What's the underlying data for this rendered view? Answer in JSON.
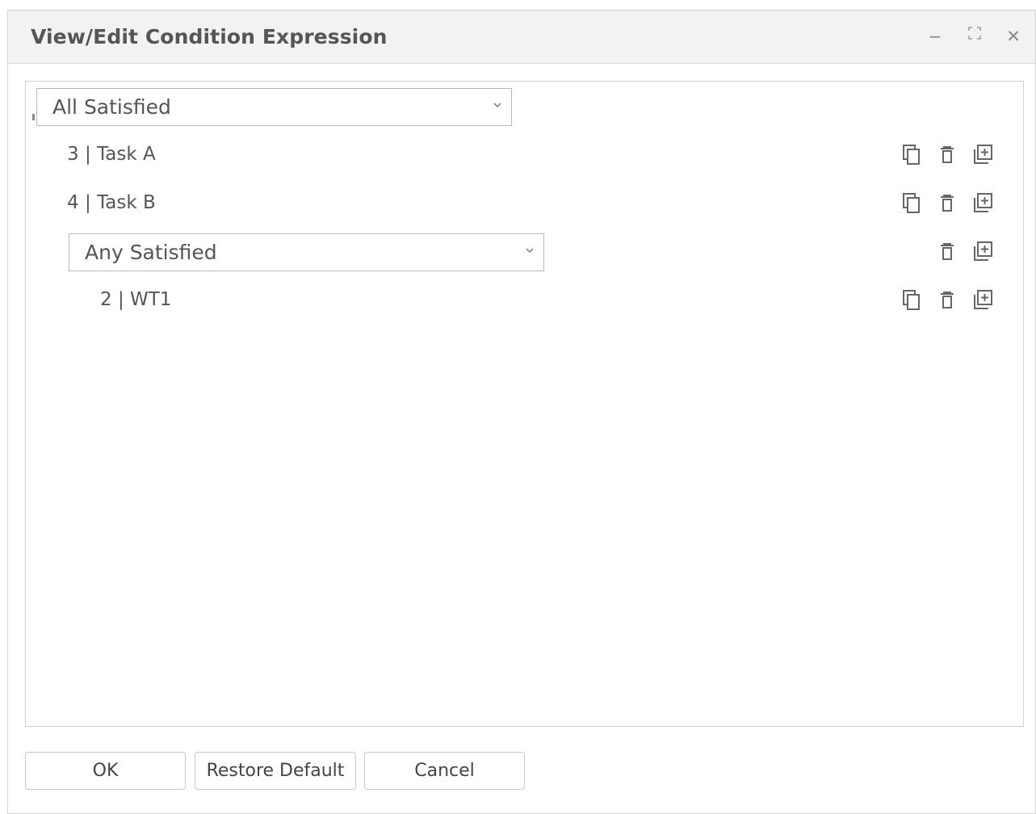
{
  "dialog": {
    "title": "View/Edit Condition Expression",
    "controls": {
      "minimize": "−",
      "maximize": "⛶",
      "close": "✕"
    }
  },
  "expression": {
    "root_select": {
      "value": "All Satisfied"
    },
    "rows": [
      {
        "label": "3 | Task A"
      },
      {
        "label": "4 | Task B"
      }
    ],
    "sub_select": {
      "value": "Any Satisfied"
    },
    "sub_rows": [
      {
        "label": "2 | WT1"
      }
    ]
  },
  "buttons": {
    "ok": "OK",
    "restore_default": "Restore Default",
    "cancel": "Cancel"
  },
  "icons": {
    "copy": "copy-icon",
    "delete": "trash-icon",
    "add": "add-child-icon",
    "chevron": "chevron-down-icon"
  },
  "colors": {
    "titlebar_bg": "#f2f2f2",
    "icon": "#666666",
    "border": "#b8b8b8"
  }
}
